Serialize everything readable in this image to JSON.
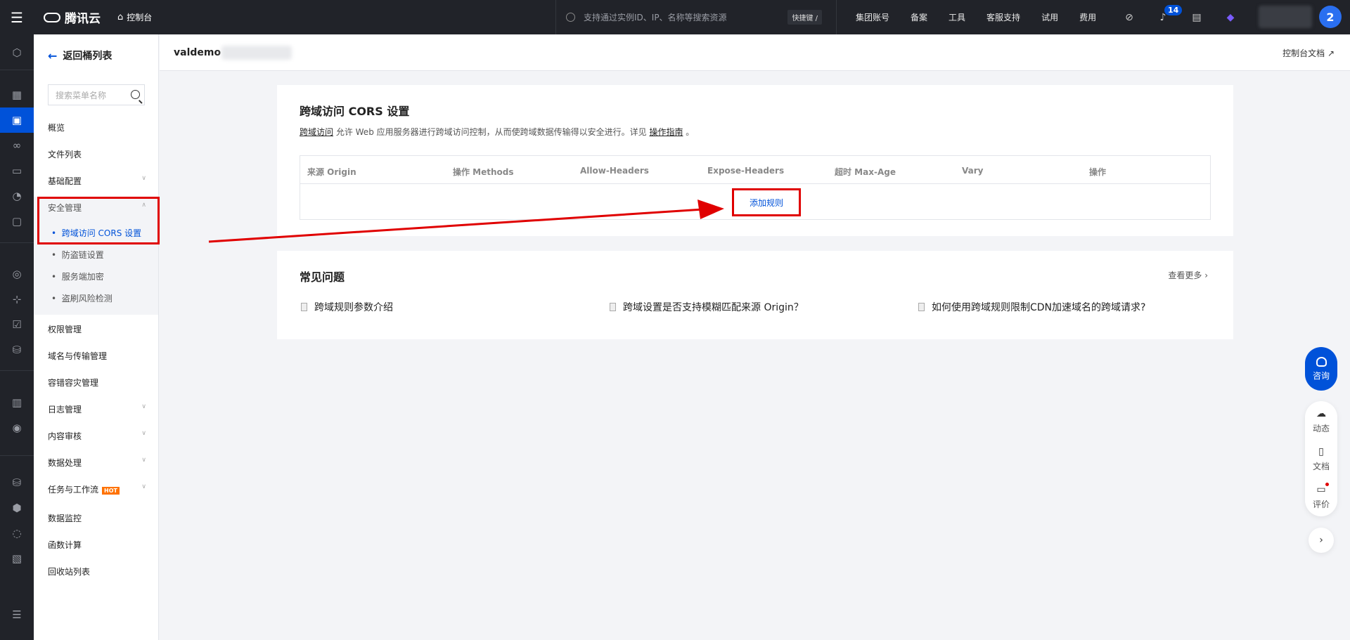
{
  "topbar": {
    "brand": "腾讯云",
    "console": "控制台",
    "search_placeholder": "支持通过实例ID、IP、名称等搜索资源",
    "shortcut": "快捷键 /",
    "nav": [
      "集团账号",
      "备案",
      "工具",
      "客服支持",
      "试用",
      "费用"
    ],
    "notification_count": "14",
    "avatar_label": "2"
  },
  "sidebar": {
    "back_label": "返回桶列表",
    "search_placeholder": "搜索菜单名称",
    "items": [
      "概览",
      "文件列表",
      "基础配置",
      "安全管理"
    ],
    "security_subitems": [
      "跨域访问 CORS 设置",
      "防盗链设置",
      "服务端加密",
      "盗刷风险检测"
    ],
    "items2": [
      "权限管理",
      "域名与传输管理",
      "容错容灾管理",
      "日志管理",
      "内容审核",
      "数据处理",
      "任务与工作流",
      "数据监控",
      "函数计算",
      "回收站列表"
    ],
    "hot_badge": "HOT"
  },
  "header": {
    "bucket_name": "valdemo",
    "doc_link": "控制台文档"
  },
  "cors": {
    "title": "跨域访问 CORS 设置",
    "desc_link1": "跨域访问",
    "desc_text": " 允许 Web 应用服务器进行跨域访问控制，从而使跨域数据传输得以安全进行。详见 ",
    "desc_link2": "操作指南",
    "desc_end": " 。",
    "columns": [
      "来源 Origin",
      "操作 Methods",
      "Allow-Headers",
      "Expose-Headers",
      "超时 Max-Age",
      "Vary",
      "操作"
    ],
    "add_rule": "添加规则"
  },
  "faq": {
    "title": "常见问题",
    "more": "查看更多",
    "items": [
      "跨域规则参数介绍",
      "跨域设置是否支持模糊匹配来源 Origin？",
      "如何使用跨域规则限制CDN加速域名的跨域请求?"
    ]
  },
  "float_tools": {
    "consult": "咨询",
    "items": [
      "动态",
      "文档",
      "评价"
    ]
  },
  "colors": {
    "brand": "#0052d9",
    "highlight": "#e00000",
    "topbar_bg": "#212329"
  }
}
